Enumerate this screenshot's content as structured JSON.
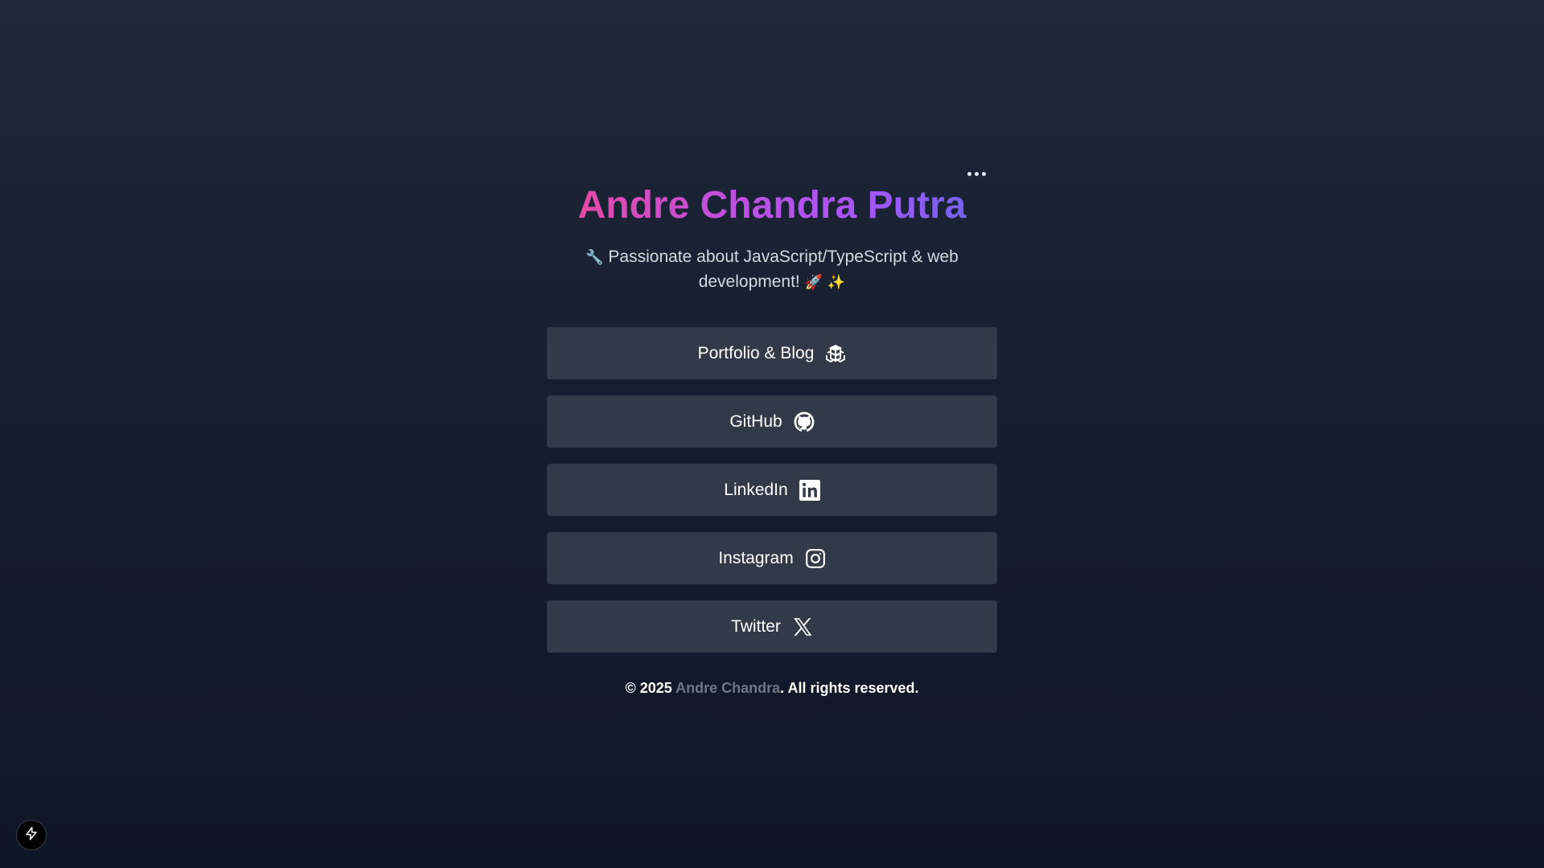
{
  "profile": {
    "name": "Andre Chandra Putra",
    "bio": {
      "prefix_emoji": "🔧",
      "text": " Passionate about JavaScript/TypeScript & web development! ",
      "suffix_emoji_1": "🚀",
      "suffix_emoji_2": "✨"
    }
  },
  "menu": {
    "icon": "more-horizontal-icon"
  },
  "links": [
    {
      "label": "Portfolio & Blog",
      "icon": "stack-icon"
    },
    {
      "label": "GitHub",
      "icon": "github-icon"
    },
    {
      "label": "LinkedIn",
      "icon": "linkedin-icon"
    },
    {
      "label": "Instagram",
      "icon": "instagram-icon"
    },
    {
      "label": "Twitter",
      "icon": "x-icon"
    }
  ],
  "footer": {
    "prefix": "© 2025 ",
    "name": "Andre Chandra",
    "suffix": ". All rights reserved."
  },
  "dev_badge": {
    "icon": "lightning-bolt-icon"
  },
  "colors": {
    "title_gradient": [
      "#ec4899",
      "#a855f7",
      "#6366f1"
    ],
    "button_bg": "#323948",
    "page_bg_top": "#1e2839",
    "page_bg_bottom": "#0f1628"
  }
}
